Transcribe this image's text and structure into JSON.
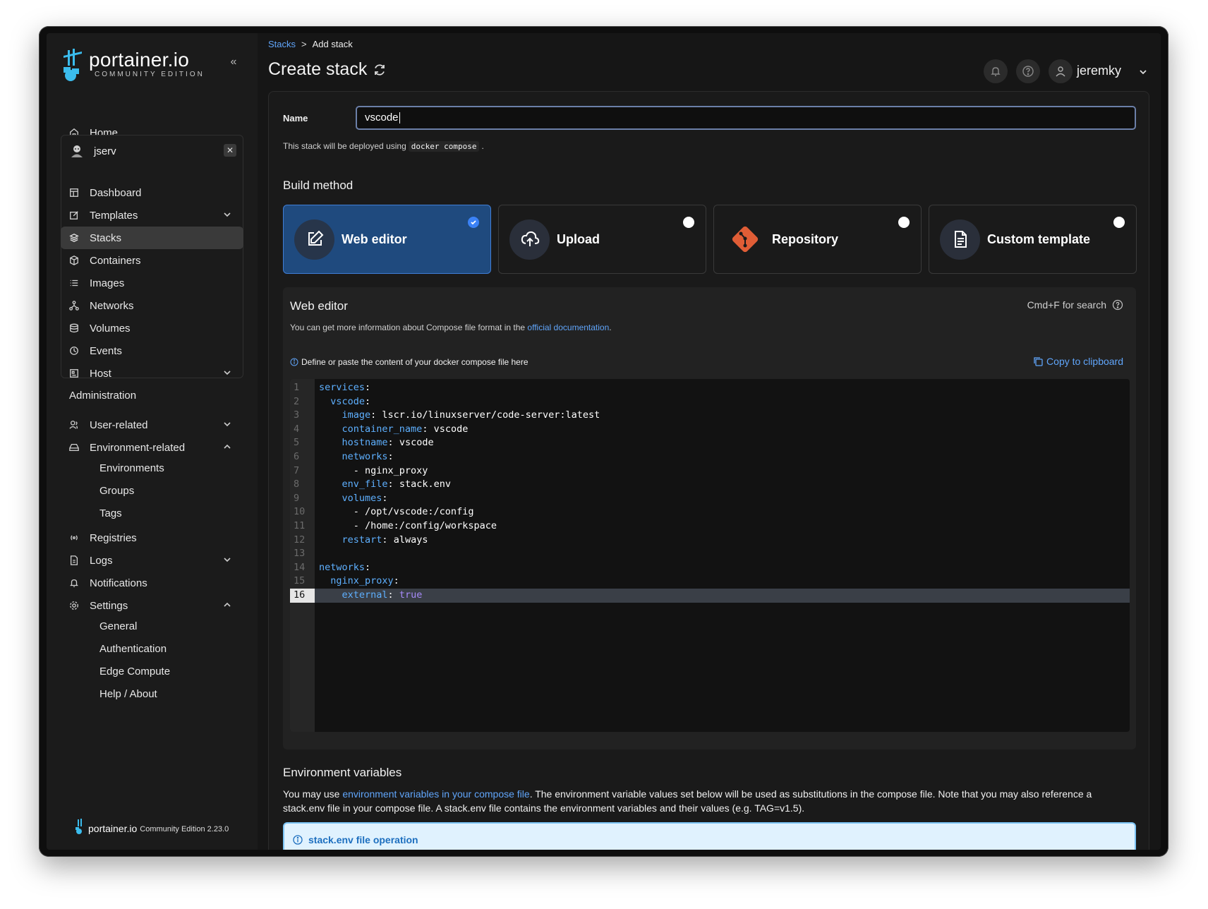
{
  "sidebar": {
    "logo": {
      "name": "portainer.io",
      "edition": "COMMUNITY EDITION"
    },
    "home": "Home",
    "environment": {
      "name": "jserv",
      "items": [
        "Dashboard",
        "Templates",
        "Stacks",
        "Containers",
        "Images",
        "Networks",
        "Volumes",
        "Events",
        "Host"
      ]
    },
    "admin": {
      "title": "Administration",
      "items": [
        "User-related",
        "Environment-related",
        "Registries",
        "Logs",
        "Notifications",
        "Settings"
      ],
      "environment_sub": [
        "Environments",
        "Groups",
        "Tags"
      ],
      "settings_sub": [
        "General",
        "Authentication",
        "Edge Compute",
        "Help / About"
      ]
    },
    "footer": {
      "brand": "portainer.io",
      "edition": "Community Edition 2.23.0"
    }
  },
  "header": {
    "breadcrumb_link": "Stacks",
    "breadcrumb_sep": ">",
    "breadcrumb_current": "Add stack",
    "title": "Create stack",
    "user": "jeremky"
  },
  "form": {
    "name_label": "Name",
    "name_value": "vscode",
    "deploy_note_prefix": "This stack will be deployed using",
    "deploy_note_code": "docker compose",
    "deploy_note_suffix": ".",
    "build_method_title": "Build method",
    "build_methods": [
      {
        "label": "Web editor",
        "selected": true
      },
      {
        "label": "Upload",
        "selected": false
      },
      {
        "label": "Repository",
        "selected": false
      },
      {
        "label": "Custom template",
        "selected": false
      }
    ]
  },
  "editor": {
    "title": "Web editor",
    "search_hint": "Cmd+F for search",
    "info_prefix": "You can get more information about Compose file format in the",
    "info_link": "official documentation",
    "info_suffix": ".",
    "define_text": "Define or paste the content of your docker compose file here",
    "copy_label": "Copy to clipboard",
    "active_line": 16,
    "lines": [
      "services:",
      "  vscode:",
      "    image: lscr.io/linuxserver/code-server:latest",
      "    container_name: vscode",
      "    hostname: vscode",
      "    networks:",
      "      - nginx_proxy",
      "    env_file: stack.env",
      "    volumes:",
      "      - /opt/vscode:/config",
      "      - /home:/config/workspace",
      "    restart: always",
      "",
      "networks:",
      "  nginx_proxy:",
      "    external: true"
    ]
  },
  "env_vars": {
    "title": "Environment variables",
    "desc_prefix": "You may use",
    "desc_link": "environment variables in your compose file",
    "desc_suffix": ". The environment variable values set below will be used as substitutions in the compose file. Note that you may also reference a stack.env file in your compose file. A stack.env file contains the environment variables and their values (e.g. TAG=v1.5).",
    "alert": "stack.env file operation"
  },
  "colors": {
    "accent": "#3b82f6",
    "link": "#60a5fa",
    "selected_card": "#1f4a7e",
    "git_orange": "#e05d36"
  }
}
